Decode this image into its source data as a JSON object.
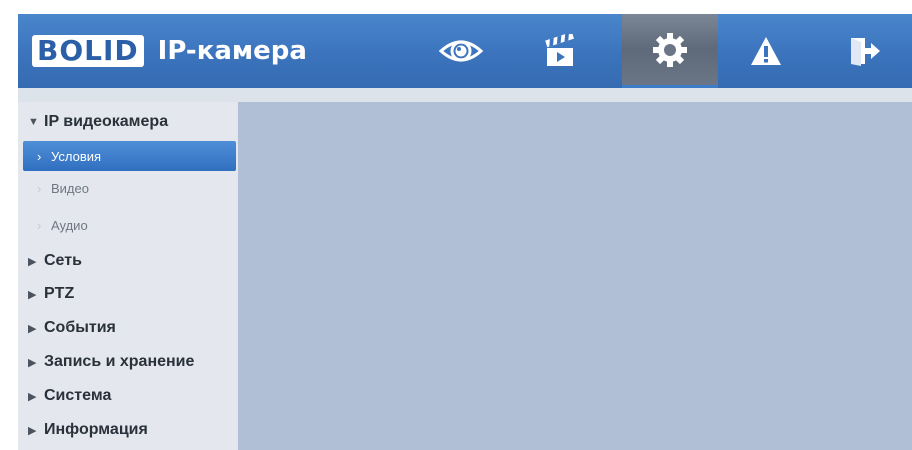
{
  "header": {
    "logo_text": "BOLID",
    "product_title": "IP-камера",
    "nav": [
      {
        "icon": "eye-icon",
        "name": "live-view"
      },
      {
        "icon": "clapperboard-icon",
        "name": "playback"
      },
      {
        "icon": "gear-icon",
        "name": "settings",
        "active": true
      },
      {
        "icon": "warning-icon",
        "name": "alarm"
      },
      {
        "icon": "exit-icon",
        "name": "logout"
      }
    ]
  },
  "sidebar": {
    "sections": [
      {
        "label": "IP видеокамера",
        "expanded": true
      },
      {
        "label": "Сеть"
      },
      {
        "label": "PTZ"
      },
      {
        "label": "События"
      },
      {
        "label": "Запись и хранение"
      },
      {
        "label": "Система"
      },
      {
        "label": "Информация"
      }
    ],
    "subitems": [
      {
        "label": "Условия",
        "selected": true
      },
      {
        "label": "Видео"
      },
      {
        "label": "Аудио"
      }
    ]
  },
  "colors": {
    "header_blue": "#3b74bd",
    "selected_blue": "#2f6fbf",
    "content_bg": "#b0bfd5",
    "sidebar_bg": "#e4e8ee"
  }
}
